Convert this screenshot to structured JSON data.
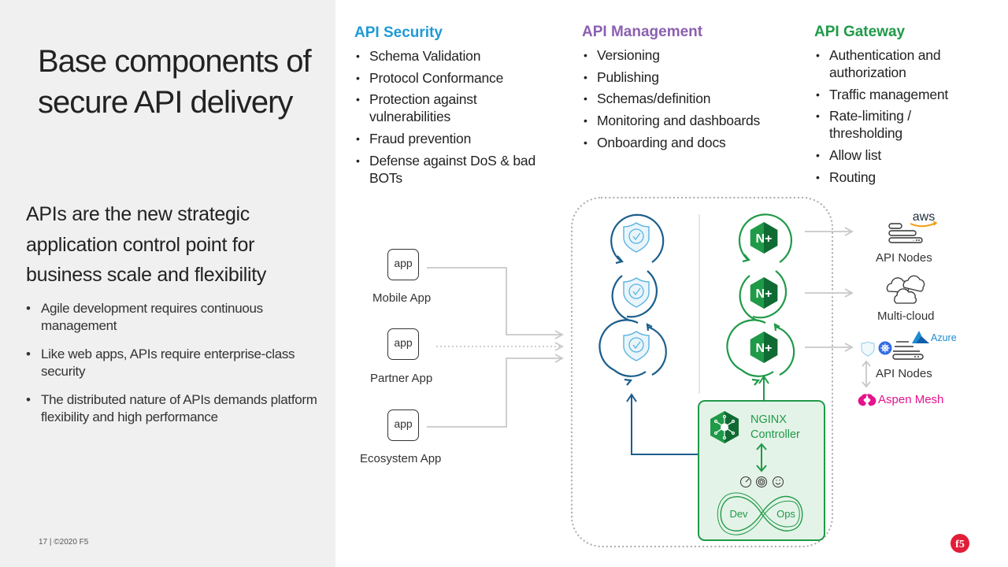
{
  "slide": {
    "title": "Base components of secure API delivery",
    "subtitle": "APIs are the new strategic application control point for business scale and flexibility",
    "bullets": [
      "Agile development requires continuous management",
      "Like web apps, APIs require enterprise-class security",
      "The distributed nature of APIs demands platform flexibility and high performance"
    ],
    "footer": "17 | ©2020 F5",
    "logo": "f5-logo"
  },
  "columns": [
    {
      "heading": "API Security",
      "color": "#1e9ad6",
      "items": [
        "Schema Validation",
        "Protocol Conformance",
        "Protection against vulnerabilities",
        "Fraud prevention",
        "Defense against DoS & bad BOTs"
      ]
    },
    {
      "heading": "API Management",
      "color": "#8b5fb0",
      "items": [
        "Versioning",
        "Publishing",
        "Schemas/definition",
        "Monitoring and dashboards",
        "Onboarding and docs"
      ]
    },
    {
      "heading": "API Gateway",
      "color": "#1f9a48",
      "items": [
        "Authentication and authorization",
        "Traffic management",
        "Rate-limiting / thresholding",
        "Allow list",
        "Routing"
      ]
    }
  ],
  "diagram": {
    "apps": [
      {
        "icon_text": "app",
        "label": "Mobile App",
        "connection": "solid"
      },
      {
        "icon_text": "app",
        "label": "Partner App",
        "connection": "dotted"
      },
      {
        "icon_text": "app",
        "label": "Ecosystem App",
        "connection": "solid"
      }
    ],
    "security_nodes": [
      "shield-check-icon",
      "shield-check-icon",
      "shield-check-icon"
    ],
    "gateway_nodes": [
      {
        "icon": "nginx-plus-icon",
        "text": "N+"
      },
      {
        "icon": "nginx-plus-icon",
        "text": "N+"
      },
      {
        "icon": "nginx-plus-icon",
        "text": "N+"
      }
    ],
    "controller": {
      "line1": "NGINX",
      "line2": "Controller",
      "devops_left": "Dev",
      "devops_right": "Ops"
    },
    "targets": [
      {
        "label": "API Nodes",
        "brand": "aws"
      },
      {
        "label": "Multi-cloud"
      },
      {
        "label": "API Nodes",
        "brand": "Azure"
      }
    ],
    "mesh_label": "Aspen Mesh",
    "colors": {
      "security": "#1b5e8c",
      "security_light": "#5ab4e0",
      "gateway": "#1f9a48",
      "gateway_dark": "#0f6b33",
      "arrow_gray": "#c8c8c8",
      "mesh": "#e4148c"
    }
  }
}
